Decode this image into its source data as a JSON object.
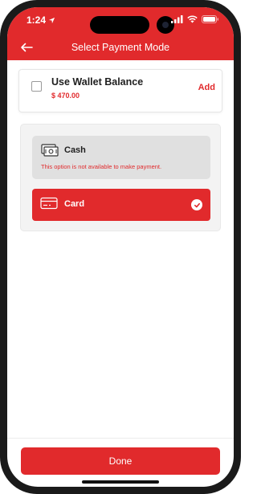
{
  "status_bar": {
    "time": "1:24",
    "icons": [
      "location-arrow-icon",
      "signal-icon",
      "wifi-icon",
      "battery-icon"
    ]
  },
  "header": {
    "title": "Select Payment Mode",
    "back_icon": "back-arrow-icon"
  },
  "wallet": {
    "title": "Use Wallet Balance",
    "balance": "$ 470.00",
    "add_label": "Add",
    "checked": false
  },
  "payment_modes": [
    {
      "label": "Cash",
      "icon": "cash-icon",
      "note": "This option is not available to make payment.",
      "available": false,
      "selected": false
    },
    {
      "label": "Card",
      "icon": "card-icon",
      "available": true,
      "selected": true
    }
  ],
  "footer": {
    "done_label": "Done"
  },
  "colors": {
    "accent": "#e12a2c",
    "disabled_bg": "#e0e0e0",
    "panel_bg": "#f3f3f3"
  }
}
